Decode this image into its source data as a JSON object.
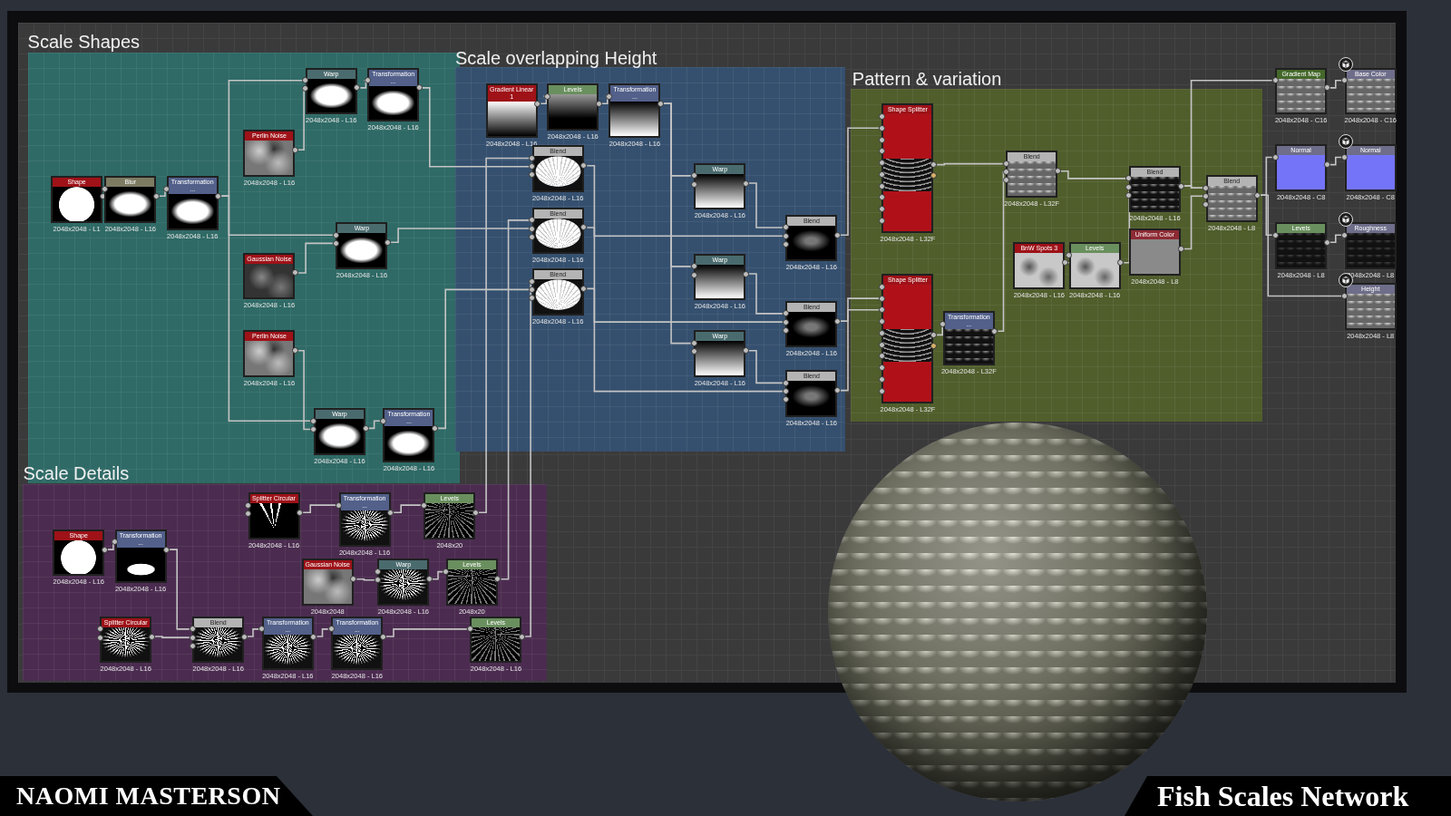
{
  "groups": [
    {
      "title": "Scale Shapes",
      "color": "#2f6a66"
    },
    {
      "title": "Scale overlapping Height",
      "color": "#35506f"
    },
    {
      "title": "Pattern & variation",
      "color": "#505e2c"
    },
    {
      "title": "Scale Details",
      "color": "#4b2c50"
    }
  ],
  "nodes": [
    {
      "title": "Shape",
      "resolution": "2048x2048 - L1",
      "kind": "disc",
      "color": "#9e1218",
      "output": false
    },
    {
      "title": "Blur",
      "resolution": "2048x2048 - L16",
      "kind": "soft-disc",
      "color": "#7d7b62",
      "output": false
    },
    {
      "title": "Transformation ...",
      "resolution": "2048x2048 - L16",
      "kind": "soft-disc",
      "color": "#52608a",
      "output": false
    },
    {
      "title": "Warp",
      "resolution": "2048x2048 - L16",
      "kind": "soft-disc",
      "color": "#4a6b6e",
      "output": false
    },
    {
      "title": "Transformation ...",
      "resolution": "2048x2048 - L16",
      "kind": "soft-disc",
      "color": "#52608a",
      "output": false
    },
    {
      "title": "Perlin Noise",
      "resolution": "2048x2048 - L16",
      "kind": "noise",
      "color": "#9e1218",
      "output": false
    },
    {
      "title": "Warp",
      "resolution": "2048x2048 - L16",
      "kind": "soft-disc",
      "color": "#4a6b6e",
      "output": false
    },
    {
      "title": "Gaussian Noise",
      "resolution": "2048x2048 - L16",
      "kind": "dark-noise",
      "color": "#9e1218",
      "output": false
    },
    {
      "title": "Perlin Noise",
      "resolution": "2048x2048 - L16",
      "kind": "noise",
      "color": "#9e1218",
      "output": false
    },
    {
      "title": "Warp",
      "resolution": "2048x2048 - L16",
      "kind": "soft-disc",
      "color": "#4a6b6e",
      "output": false
    },
    {
      "title": "Transformation ...",
      "resolution": "2048x2048 - L16",
      "kind": "soft-disc",
      "color": "#52608a",
      "output": false
    },
    {
      "title": "Gradient Linear 1",
      "resolution": "2048x2048 - L16",
      "kind": "gradient",
      "color": "#9e1218",
      "output": false
    },
    {
      "title": "Levels",
      "resolution": "2048x2048 - L16",
      "kind": "gradient-dark",
      "color": "#6a8f5e",
      "output": false
    },
    {
      "title": "Transformation ...",
      "resolution": "2048x2048 - L16",
      "kind": "gradient-up",
      "color": "#52608a",
      "output": false
    },
    {
      "title": "Blend",
      "resolution": "2048x2048 - L16",
      "kind": "shell",
      "color": "#b4b4b4",
      "output": false
    },
    {
      "title": "Blend",
      "resolution": "2048x2048 - L16",
      "kind": "shell",
      "color": "#b4b4b4",
      "output": false
    },
    {
      "title": "Blend",
      "resolution": "2048x2048 - L16",
      "kind": "shell",
      "color": "#b4b4b4",
      "output": false
    },
    {
      "title": "Warp",
      "resolution": "2048x2048 - L16",
      "kind": "gradient-up",
      "color": "#4a6b6e",
      "output": false
    },
    {
      "title": "Warp",
      "resolution": "2048x2048 - L16",
      "kind": "gradient-up",
      "color": "#4a6b6e",
      "output": false
    },
    {
      "title": "Warp",
      "resolution": "2048x2048 - L16",
      "kind": "gradient-up",
      "color": "#4a6b6e",
      "output": false
    },
    {
      "title": "Blend",
      "resolution": "2048x2048 - L16",
      "kind": "dim-disc",
      "color": "#b4b4b4",
      "output": false
    },
    {
      "title": "Blend",
      "resolution": "2048x2048 - L16",
      "kind": "dim-disc",
      "color": "#b4b4b4",
      "output": false
    },
    {
      "title": "Blend",
      "resolution": "2048x2048 - L16",
      "kind": "dim-disc",
      "color": "#b4b4b4",
      "output": false
    },
    {
      "title": "Shape Splitter",
      "resolution": "2048x2048 - L32F",
      "kind": "splitter",
      "color": "#9e1218",
      "output": false
    },
    {
      "title": "Shape Splitter",
      "resolution": "2048x2048 - L32F",
      "kind": "splitter",
      "color": "#9e1218",
      "output": false
    },
    {
      "title": "Blend",
      "resolution": "2048x2048 - L32F",
      "kind": "scales",
      "color": "#b4b4b4",
      "output": false
    },
    {
      "title": "Transformation ...",
      "resolution": "2048x2048 - L32F",
      "kind": "dark-scales",
      "color": "#52608a",
      "output": false
    },
    {
      "title": "BnW Spots 3",
      "resolution": "2048x2048 - L16",
      "kind": "light-noise",
      "color": "#9e1218",
      "output": false
    },
    {
      "title": "Levels",
      "resolution": "2048x2048 - L16",
      "kind": "light-noise",
      "color": "#6a8f5e",
      "output": false
    },
    {
      "title": "Blend",
      "resolution": "2048x2048 - L16",
      "kind": "dark-scales",
      "color": "#b4b4b4",
      "output": false
    },
    {
      "title": "Uniform Color",
      "resolution": "2048x2048 - L8",
      "kind": "flat",
      "color": "#8d2a33",
      "output": false
    },
    {
      "title": "Blend",
      "resolution": "2048x2048 - L8",
      "kind": "scales",
      "color": "#b4b4b4",
      "output": false
    },
    {
      "title": "Gradient Map",
      "resolution": "2048x2048 - C16",
      "kind": "scales",
      "color": "#44682a",
      "output": false
    },
    {
      "title": "Base Color",
      "resolution": "2048x2048 - C16",
      "kind": "scales",
      "color": "#6e6e8a",
      "output": true
    },
    {
      "title": "Normal",
      "resolution": "2048x2048 - C8",
      "kind": "normal",
      "color": "#6e6e8a",
      "output": false
    },
    {
      "title": "Normal",
      "resolution": "2048x2048 - C8",
      "kind": "normal",
      "color": "#6e6e8a",
      "output": true
    },
    {
      "title": "Levels",
      "resolution": "2048x2048 - L8",
      "kind": "black-scales",
      "color": "#6a8f5e",
      "output": false
    },
    {
      "title": "Roughness",
      "resolution": "2048x2048 - L8",
      "kind": "black-scales",
      "color": "#6e6e8a",
      "output": true
    },
    {
      "title": "Height",
      "resolution": "2048x2048 - L8",
      "kind": "scales",
      "color": "#6e6e8a",
      "output": true
    },
    {
      "title": "Shape",
      "resolution": "2048x2048 - L16",
      "kind": "disc",
      "color": "#9e1218",
      "output": false
    },
    {
      "title": "Transformation ...",
      "resolution": "2048x2048 - L16",
      "kind": "small-ellipse",
      "color": "#52608a",
      "output": false
    },
    {
      "title": "Splitter Circular",
      "resolution": "2048x2048 - L16",
      "kind": "spikes",
      "color": "#9e1218",
      "output": false
    },
    {
      "title": "Transformation ...",
      "resolution": "2048x2048 - L16",
      "kind": "fan",
      "color": "#52608a",
      "output": false
    },
    {
      "title": "Levels",
      "resolution": "2048x20",
      "kind": "dim-fan",
      "color": "#6a8f5e",
      "output": false
    },
    {
      "title": "Gaussian Noise",
      "resolution": "2048x2048",
      "kind": "noise",
      "color": "#9e1218",
      "output": false
    },
    {
      "title": "Warp",
      "resolution": "2048x2048 - L16",
      "kind": "fan",
      "color": "#4a6b6e",
      "output": false
    },
    {
      "title": "Levels",
      "resolution": "2048x20",
      "kind": "dim-fan",
      "color": "#6a8f5e",
      "output": false
    },
    {
      "title": "Splitter Circular",
      "resolution": "2048x2048 - L16",
      "kind": "fan",
      "color": "#9e1218",
      "output": false
    },
    {
      "title": "Blend",
      "resolution": "2048x2048 - L16",
      "kind": "fan",
      "color": "#b4b4b4",
      "output": false
    },
    {
      "title": "Transformation ...",
      "resolution": "2048x2048 - L16",
      "kind": "fan",
      "color": "#52608a",
      "output": false
    },
    {
      "title": "Transformation ...",
      "resolution": "2048x2048 - L16",
      "kind": "fan",
      "color": "#52608a",
      "output": false
    },
    {
      "title": "Levels",
      "resolution": "2048x2048 - L16",
      "kind": "dim-fan",
      "color": "#6a8f5e",
      "output": false
    }
  ],
  "author": "NAOMI MASTERSON",
  "title": "Fish Scales Network"
}
